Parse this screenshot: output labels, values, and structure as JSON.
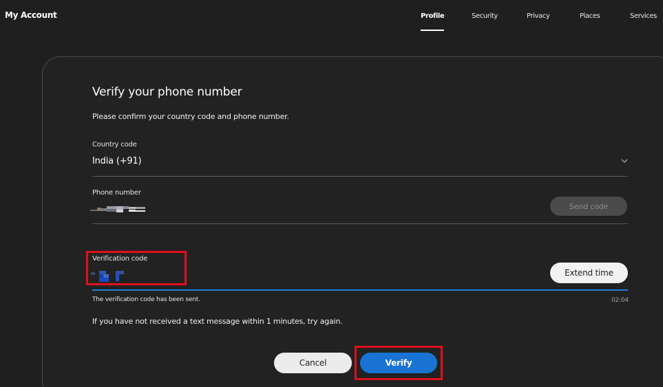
{
  "header": {
    "brand": "My Account",
    "tabs": [
      {
        "label": "Profile",
        "active": true
      },
      {
        "label": "Security",
        "active": false
      },
      {
        "label": "Privacy",
        "active": false
      },
      {
        "label": "Places",
        "active": false
      },
      {
        "label": "Services",
        "active": false
      }
    ]
  },
  "form": {
    "title": "Verify your phone number",
    "subtitle": "Please confirm your country code and phone number.",
    "country": {
      "label": "Country code",
      "value": "India (+91)",
      "icon": "chevron-down-icon"
    },
    "phone": {
      "label": "Phone number",
      "send_code_label": "Send code"
    },
    "verification": {
      "label": "Verification code",
      "extend_label": "Extend time",
      "status_message": "The verification code has been sent.",
      "timer": "02:04"
    },
    "retry_message": "If you have not received a text message within 1 minutes, try again.",
    "cancel_label": "Cancel",
    "verify_label": "Verify"
  },
  "colors": {
    "background": "#1f1f1f",
    "accent": "#1873d3",
    "highlight": "#e0101c"
  }
}
